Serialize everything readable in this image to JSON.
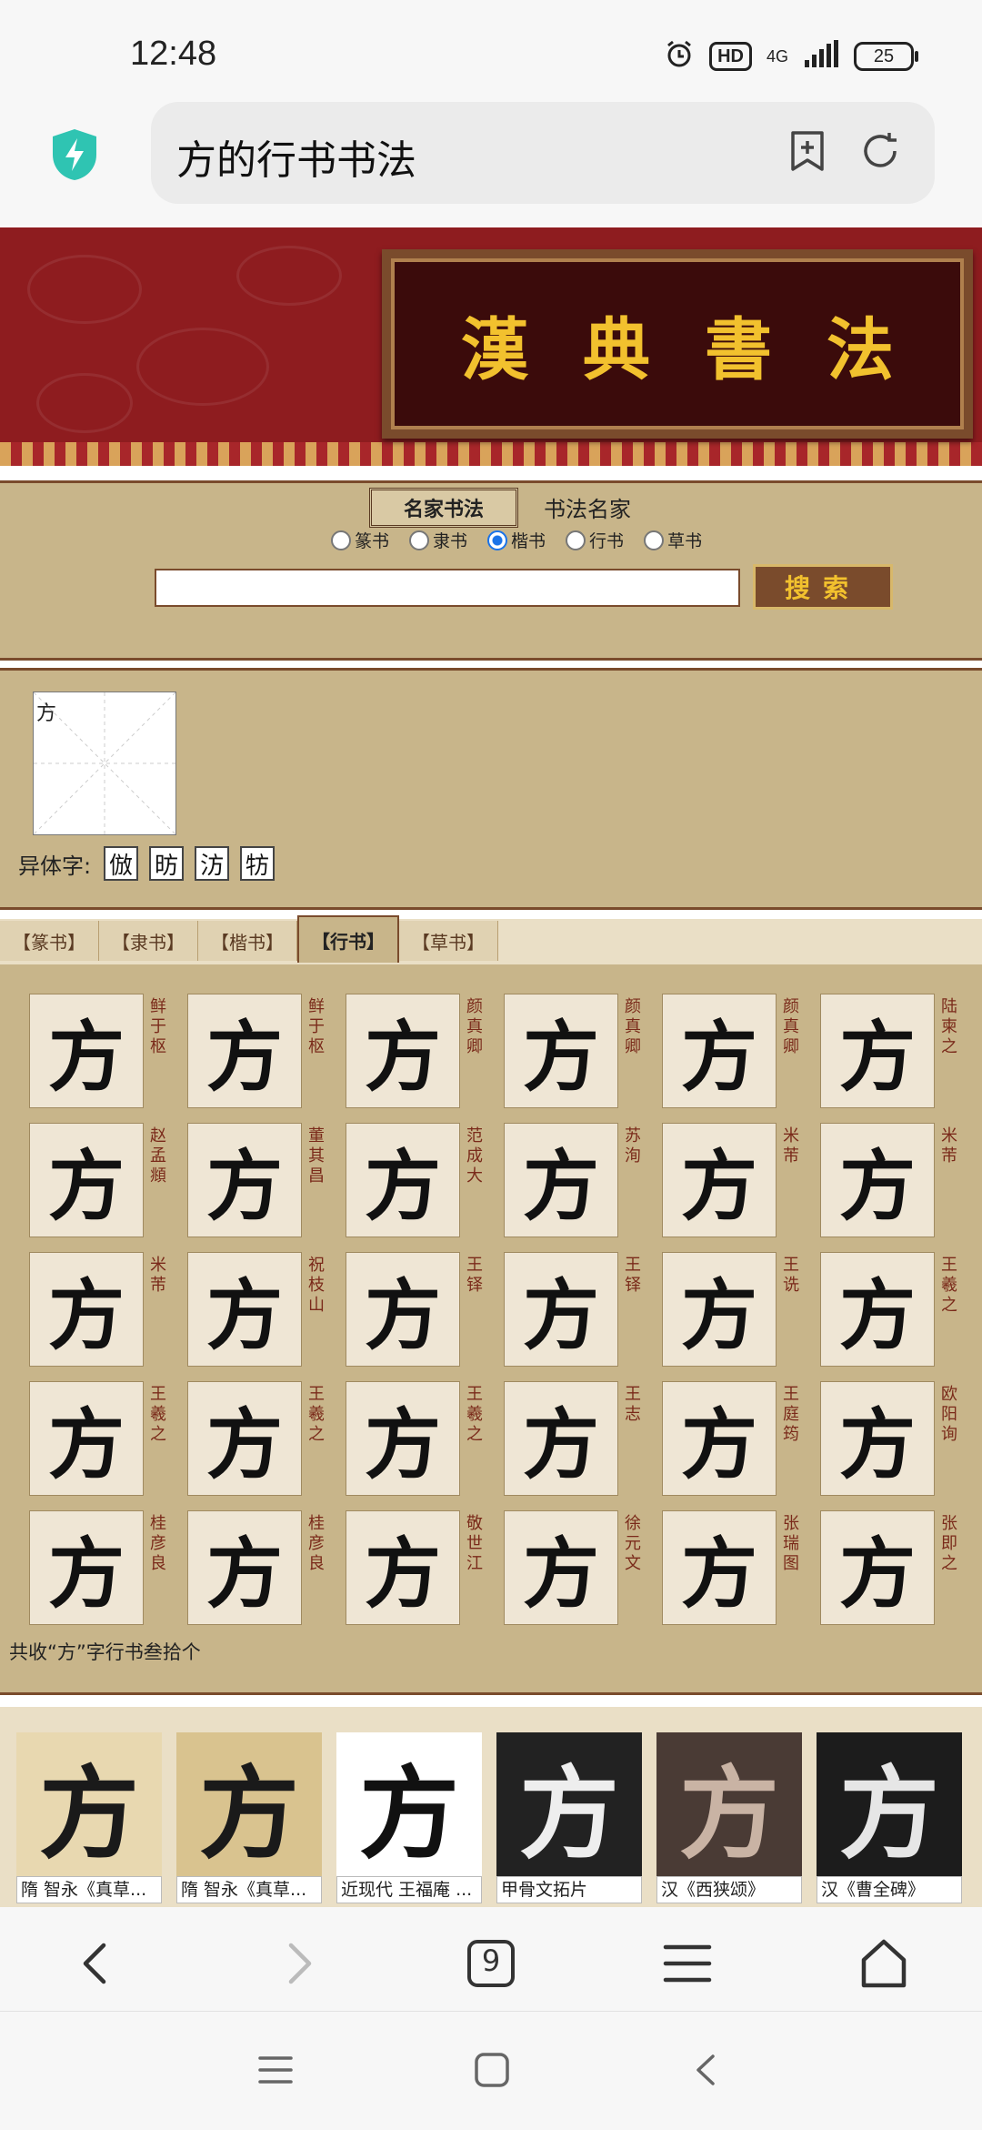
{
  "status_bar": {
    "time": "12:48",
    "hd": "HD",
    "network": "4G",
    "battery": "25"
  },
  "browser": {
    "url_title": "方的行书书法"
  },
  "banner": {
    "chars": [
      "漢",
      "典",
      "書",
      "法"
    ]
  },
  "search": {
    "tab_active": "名家书法",
    "tab_other": "书法名家",
    "radios": [
      {
        "label": "篆书",
        "checked": false
      },
      {
        "label": "隶书",
        "checked": false
      },
      {
        "label": "楷书",
        "checked": true
      },
      {
        "label": "行书",
        "checked": false
      },
      {
        "label": "草书",
        "checked": false
      }
    ],
    "button": "搜索"
  },
  "character": {
    "alt": "方",
    "variant_label": "异体字:",
    "variants": [
      "倣",
      "昉",
      "汸",
      "牥"
    ]
  },
  "script_tabs": [
    "【篆书】",
    "【隶书】",
    "【楷书】",
    "【行书】",
    "【草书】"
  ],
  "active_tab_index": 3,
  "calligraphy": [
    {
      "glyph": "方",
      "author": "鲜于枢"
    },
    {
      "glyph": "方",
      "author": "鲜于枢"
    },
    {
      "glyph": "方",
      "author": "颜真卿"
    },
    {
      "glyph": "方",
      "author": "颜真卿"
    },
    {
      "glyph": "方",
      "author": "颜真卿"
    },
    {
      "glyph": "方",
      "author": "陆柬之"
    },
    {
      "glyph": "方",
      "author": "赵孟頫"
    },
    {
      "glyph": "方",
      "author": "董其昌"
    },
    {
      "glyph": "方",
      "author": "范成大"
    },
    {
      "glyph": "方",
      "author": "苏洵"
    },
    {
      "glyph": "方",
      "author": "米芾"
    },
    {
      "glyph": "方",
      "author": "米芾"
    },
    {
      "glyph": "方",
      "author": "米芾"
    },
    {
      "glyph": "方",
      "author": "祝枝山"
    },
    {
      "glyph": "方",
      "author": "王铎"
    },
    {
      "glyph": "方",
      "author": "王铎"
    },
    {
      "glyph": "方",
      "author": "王诜"
    },
    {
      "glyph": "方",
      "author": "王羲之"
    },
    {
      "glyph": "方",
      "author": "王羲之"
    },
    {
      "glyph": "方",
      "author": "王羲之"
    },
    {
      "glyph": "方",
      "author": "王羲之"
    },
    {
      "glyph": "方",
      "author": "王志"
    },
    {
      "glyph": "方",
      "author": "王庭筠"
    },
    {
      "glyph": "方",
      "author": "欧阳询"
    },
    {
      "glyph": "方",
      "author": "桂彦良"
    },
    {
      "glyph": "方",
      "author": "桂彦良"
    },
    {
      "glyph": "方",
      "author": "敬世江"
    },
    {
      "glyph": "方",
      "author": "徐元文"
    },
    {
      "glyph": "方",
      "author": "张瑞图"
    },
    {
      "glyph": "方",
      "author": "张即之"
    }
  ],
  "summary": "共收“方”字行书叁拾个",
  "gallery": [
    {
      "caption": "隋 智永《真草...",
      "bg": "#e8d8b0",
      "fg": "#1a1a1a",
      "glyph": "方"
    },
    {
      "caption": "隋 智永《真草...",
      "bg": "#d9c38f",
      "fg": "#1a1a1a",
      "glyph": "方"
    },
    {
      "caption": "近现代 王福庵 ...",
      "bg": "#ffffff",
      "fg": "#111111",
      "glyph": "方"
    },
    {
      "caption": "甲骨文拓片",
      "bg": "#222222",
      "fg": "#eeeeee",
      "glyph": "方"
    },
    {
      "caption": "汉《西狭颂》",
      "bg": "#4a3b35",
      "fg": "#c9b3a4",
      "glyph": "方"
    },
    {
      "caption": "汉《曹全碑》",
      "bg": "#1c1c1c",
      "fg": "#e6e6e6",
      "glyph": "方"
    }
  ],
  "tab_count": "9"
}
